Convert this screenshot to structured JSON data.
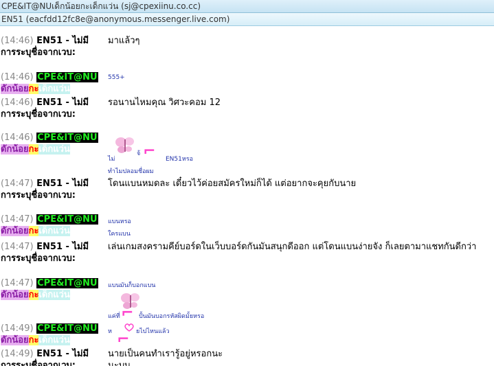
{
  "header": {
    "line1": "CPE&IT@NUเด็กน้อยกะเด็กแว่น (sj@cpexiinu.co.cc)",
    "line2": "EN51 (eacfdd12fc8e@anonymous.messenger.live.com)"
  },
  "nick": {
    "en51": "EN51 - ไม่มีการระบุชื่อจากเวบ:",
    "cpe_a": "CPE&IT@NU",
    "cpe_b1": "ดักน้อย",
    "cpe_b2": "กะ",
    "cpe_b3": "เด็กแว่น"
  },
  "messages": [
    {
      "time": "(14:46)",
      "text": "มาแล้วๆ"
    },
    {
      "time": "(14:46)",
      "text": "555+"
    },
    {
      "time": "(14:46)",
      "text": "รอนานไหมคุณ วิศวะคอม 12"
    },
    {
      "time": "(14:46)",
      "text_a": "ไม่",
      "text_b": "จ้",
      "text_c": "EN51หรอ",
      "text_d": "ทำไมปลอมชื่อผม"
    },
    {
      "time": "(14:47)",
      "text": "โดนแบนหมดละ เดี๋ยวไว้ค่อยสมัครใหม่ก็ได้ แต่อยากจะคุยกับนาย"
    },
    {
      "time": "(14:47)",
      "text_a": "แบนหรอ",
      "text_b": "ใครแบน"
    },
    {
      "time": "(14:47)",
      "text": "เล่นเกมสงครามคีย์บอร์ดในเว็บบอร์ดกันมันสนุกดีออก แต่โดนแบนง่ายจัง ก็เลยตามาแชทกันดีกว่า"
    },
    {
      "time": "(14:47)",
      "text_a": "แบนมันก็บอกแบน"
    },
    {
      "time": "(14:49)",
      "text_a": "แค่ที่",
      "text_b": "ปั้นมันบอกรหัสผิดมั้ยหรอ",
      "text_c": "ห",
      "text_d": "ยไปไหนแล้ว"
    },
    {
      "time": "(14:49)",
      "text": "นายเป็นคนทำเรารู้อยู่หรอกนะ",
      "text2": "นะบบ"
    }
  ],
  "colors": {
    "header_bg": "#c6e3f3",
    "nick_black": "#000000",
    "nick_green": "#22ee22",
    "nick_purple": "#e7b0f0",
    "nick_yellow": "#fffe6a",
    "nick_cyan": "#c6f2f0",
    "small_text": "#2233aa",
    "pink": "#ff44cc"
  },
  "icons": [
    "butterfly-emoticon",
    "pink-hook-glyph",
    "heart-emoticon"
  ]
}
